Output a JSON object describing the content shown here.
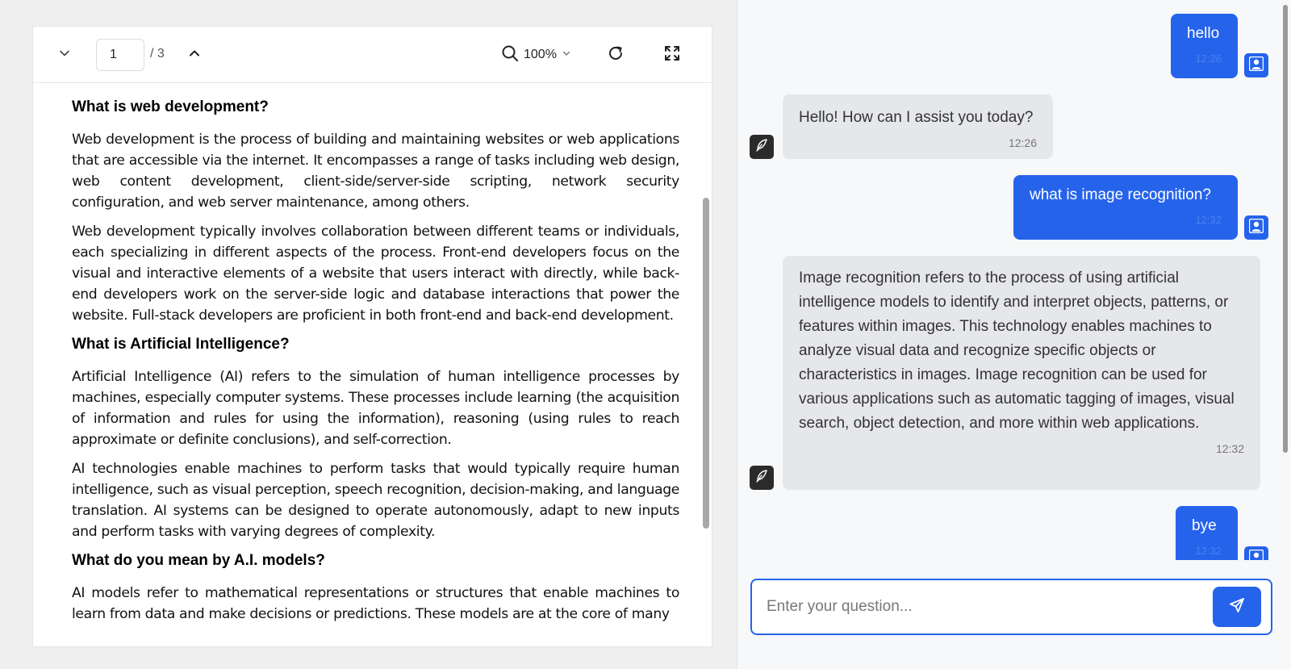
{
  "pdf_viewer": {
    "page_input_value": "1",
    "page_total": "/ 3",
    "zoom_label": "100%",
    "icons": {
      "prev_page": "chevron-down-icon",
      "next_page": "chevron-up-icon",
      "zoom": "search-icon",
      "zoom_dropdown": "chevron-down-icon",
      "rotate": "rotate-icon",
      "fullscreen": "fullscreen-icon"
    },
    "document": {
      "sections": [
        {
          "heading": "What is web development?",
          "paragraphs": [
            "Web development is the process of building and maintaining websites or web applications that are accessible via the internet. It encompasses a range of tasks including web design, web content development, client-side/server-side scripting, network security configuration, and web server maintenance, among others.",
            "Web development typically involves collaboration between different teams or individuals, each specializing in different aspects of the process. Front-end developers focus on the visual and interactive elements of a website that users interact with directly, while back-end developers work on the server-side logic and database interactions that power the website. Full-stack developers are proficient in both front-end and back-end development."
          ]
        },
        {
          "heading": "What is Artificial Intelligence?",
          "paragraphs": [
            "Artificial Intelligence (AI) refers to the simulation of human intelligence processes by machines, especially computer systems. These processes include learning (the acquisition of information and rules for using the information), reasoning (using rules to reach approximate or definite conclusions), and self-correction.",
            "AI technologies enable machines to perform tasks that would typically require human intelligence, such as visual perception, speech recognition, decision-making, and language translation. AI systems can be designed to operate autonomously, adapt to new inputs and perform tasks with varying degrees of complexity."
          ]
        },
        {
          "heading": "What do you mean by A.I. models?",
          "paragraphs": [
            "AI models refer to mathematical representations or structures that enable machines to learn from data and make decisions or predictions. These models are at the core of many"
          ]
        }
      ]
    }
  },
  "chat": {
    "messages": [
      {
        "role": "user",
        "text": "hello",
        "time": "12:26"
      },
      {
        "role": "bot",
        "text": "Hello! How can I assist you today?",
        "time": "12:26"
      },
      {
        "role": "user",
        "text": "what is image recognition?",
        "time": "12:32"
      },
      {
        "role": "bot",
        "text": "Image recognition refers to the process of using artificial intelligence models to identify and interpret objects, patterns, or features within images. This technology enables machines to analyze visual data and recognize specific objects or characteristics in images. Image recognition can be used for various applications such as automatic tagging of images, visual search, object detection, and more within web applications.",
        "time": "12:32"
      },
      {
        "role": "user",
        "text": "bye",
        "time": "12:32"
      }
    ],
    "input_placeholder": "Enter your question...",
    "input_value": "",
    "icons": {
      "user_avatar": "user-icon",
      "bot_avatar": "feather-icon",
      "send": "send-icon"
    },
    "colors": {
      "accent": "#2563eb",
      "bot_bubble": "#e6e7ea",
      "bot_avatar": "#2b2b2b"
    }
  }
}
